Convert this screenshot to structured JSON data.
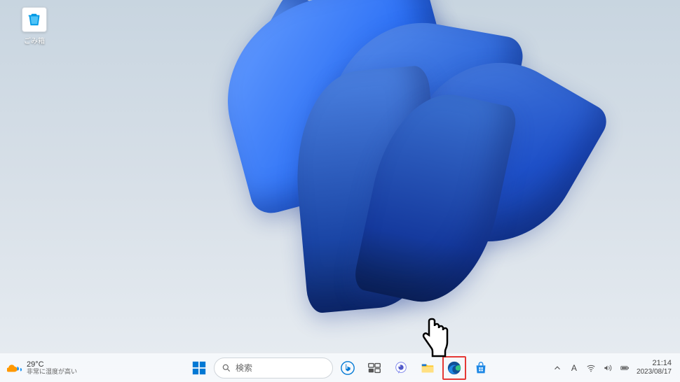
{
  "desktop": {
    "recycle_bin_label": "ごみ箱"
  },
  "taskbar": {
    "weather": {
      "temperature": "29°C",
      "description": "非常に湿度が高い"
    },
    "search_placeholder": "検索",
    "ime_mode": "A",
    "clock": {
      "time": "21:14",
      "date": "2023/08/17"
    },
    "apps": {
      "start": "start-menu",
      "search": "search",
      "bing_chat": "bing-chat",
      "task_view": "task-view",
      "chat": "chat",
      "file_explorer": "file-explorer",
      "edge": "microsoft-edge",
      "store": "microsoft-store"
    }
  },
  "annotation": {
    "highlighted_app": "microsoft-edge",
    "cursor": "pointing-hand"
  }
}
